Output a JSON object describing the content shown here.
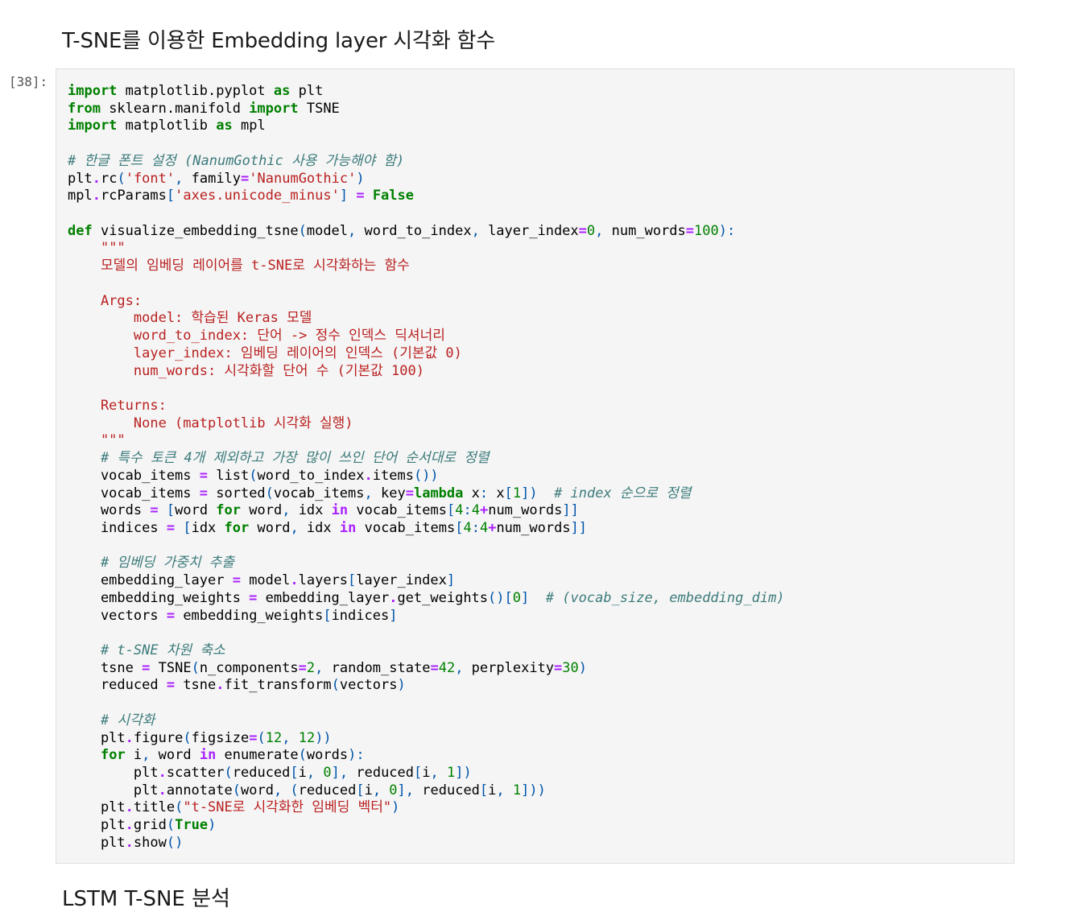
{
  "heading": "T-SNE를 이용한 Embedding layer 시각화 함수",
  "cell": {
    "prompt": "[38]:",
    "lines": [
      [
        [
          "k",
          "import"
        ],
        [
          "t",
          " matplotlib.pyplot "
        ],
        [
          "k",
          "as"
        ],
        [
          "t",
          " plt"
        ]
      ],
      [
        [
          "k",
          "from"
        ],
        [
          "t",
          " sklearn.manifold "
        ],
        [
          "k",
          "import"
        ],
        [
          "t",
          " TSNE"
        ]
      ],
      [
        [
          "k",
          "import"
        ],
        [
          "t",
          " matplotlib "
        ],
        [
          "k",
          "as"
        ],
        [
          "t",
          " mpl"
        ]
      ],
      [],
      [
        [
          "c",
          "# 한글 폰트 설정 (NanumGothic 사용 가능해야 함)"
        ]
      ],
      [
        [
          "t",
          "plt"
        ],
        [
          "o",
          "."
        ],
        [
          "t",
          "rc"
        ],
        [
          "p",
          "("
        ],
        [
          "s",
          "'font'"
        ],
        [
          "p",
          ", "
        ],
        [
          "t",
          "family"
        ],
        [
          "o",
          "="
        ],
        [
          "s",
          "'NanumGothic'"
        ],
        [
          "p",
          ")"
        ]
      ],
      [
        [
          "t",
          "mpl"
        ],
        [
          "o",
          "."
        ],
        [
          "t",
          "rcParams"
        ],
        [
          "p",
          "["
        ],
        [
          "s",
          "'axes.unicode_minus'"
        ],
        [
          "p",
          "]"
        ],
        [
          "t",
          " "
        ],
        [
          "o",
          "="
        ],
        [
          "t",
          " "
        ],
        [
          "k",
          "False"
        ]
      ],
      [],
      [
        [
          "k",
          "def"
        ],
        [
          "t",
          " visualize_embedding_tsne"
        ],
        [
          "p",
          "("
        ],
        [
          "t",
          "model"
        ],
        [
          "p",
          ", "
        ],
        [
          "t",
          "word_to_index"
        ],
        [
          "p",
          ", "
        ],
        [
          "t",
          "layer_index"
        ],
        [
          "o",
          "="
        ],
        [
          "n",
          "0"
        ],
        [
          "p",
          ", "
        ],
        [
          "t",
          "num_words"
        ],
        [
          "o",
          "="
        ],
        [
          "n",
          "100"
        ],
        [
          "p",
          "):"
        ]
      ],
      [
        [
          "t",
          "    "
        ],
        [
          "s",
          "\"\"\""
        ]
      ],
      [
        [
          "s",
          "    모델의 임베딩 레이어를 t-SNE로 시각화하는 함수"
        ]
      ],
      [],
      [
        [
          "s",
          "    Args:"
        ]
      ],
      [
        [
          "s",
          "        model: 학습된 Keras 모델"
        ]
      ],
      [
        [
          "s",
          "        word_to_index: 단어 -> 정수 인덱스 딕셔너리"
        ]
      ],
      [
        [
          "s",
          "        layer_index: 임베딩 레이어의 인덱스 (기본값 0)"
        ]
      ],
      [
        [
          "s",
          "        num_words: 시각화할 단어 수 (기본값 100)"
        ]
      ],
      [],
      [
        [
          "s",
          "    Returns:"
        ]
      ],
      [
        [
          "s",
          "        None (matplotlib 시각화 실행)"
        ]
      ],
      [
        [
          "s",
          "    \"\"\""
        ]
      ],
      [
        [
          "t",
          "    "
        ],
        [
          "c",
          "# 특수 토큰 4개 제외하고 가장 많이 쓰인 단어 순서대로 정렬"
        ]
      ],
      [
        [
          "t",
          "    vocab_items "
        ],
        [
          "o",
          "="
        ],
        [
          "t",
          " list"
        ],
        [
          "p",
          "("
        ],
        [
          "t",
          "word_to_index"
        ],
        [
          "o",
          "."
        ],
        [
          "t",
          "items"
        ],
        [
          "p",
          "())"
        ]
      ],
      [
        [
          "t",
          "    vocab_items "
        ],
        [
          "o",
          "="
        ],
        [
          "t",
          " sorted"
        ],
        [
          "p",
          "("
        ],
        [
          "t",
          "vocab_items"
        ],
        [
          "p",
          ", "
        ],
        [
          "t",
          "key"
        ],
        [
          "o",
          "="
        ],
        [
          "k",
          "lambda"
        ],
        [
          "t",
          " x"
        ],
        [
          "p",
          ":"
        ],
        [
          "t",
          " x"
        ],
        [
          "p",
          "["
        ],
        [
          "n",
          "1"
        ],
        [
          "p",
          "])"
        ],
        [
          "t",
          "  "
        ],
        [
          "c",
          "# index 순으로 정렬"
        ]
      ],
      [
        [
          "t",
          "    words "
        ],
        [
          "o",
          "="
        ],
        [
          "t",
          " "
        ],
        [
          "p",
          "["
        ],
        [
          "t",
          "word "
        ],
        [
          "k",
          "for"
        ],
        [
          "t",
          " word"
        ],
        [
          "p",
          ", "
        ],
        [
          "t",
          "idx "
        ],
        [
          "o",
          "in"
        ],
        [
          "t",
          " vocab_items"
        ],
        [
          "p",
          "["
        ],
        [
          "n",
          "4"
        ],
        [
          "p",
          ":"
        ],
        [
          "n",
          "4"
        ],
        [
          "o",
          "+"
        ],
        [
          "t",
          "num_words"
        ],
        [
          "p",
          "]]"
        ]
      ],
      [
        [
          "t",
          "    indices "
        ],
        [
          "o",
          "="
        ],
        [
          "t",
          " "
        ],
        [
          "p",
          "["
        ],
        [
          "t",
          "idx "
        ],
        [
          "k",
          "for"
        ],
        [
          "t",
          " word"
        ],
        [
          "p",
          ", "
        ],
        [
          "t",
          "idx "
        ],
        [
          "o",
          "in"
        ],
        [
          "t",
          " vocab_items"
        ],
        [
          "p",
          "["
        ],
        [
          "n",
          "4"
        ],
        [
          "p",
          ":"
        ],
        [
          "n",
          "4"
        ],
        [
          "o",
          "+"
        ],
        [
          "t",
          "num_words"
        ],
        [
          "p",
          "]]"
        ]
      ],
      [],
      [
        [
          "t",
          "    "
        ],
        [
          "c",
          "# 임베딩 가중치 추출"
        ]
      ],
      [
        [
          "t",
          "    embedding_layer "
        ],
        [
          "o",
          "="
        ],
        [
          "t",
          " model"
        ],
        [
          "o",
          "."
        ],
        [
          "t",
          "layers"
        ],
        [
          "p",
          "["
        ],
        [
          "t",
          "layer_index"
        ],
        [
          "p",
          "]"
        ]
      ],
      [
        [
          "t",
          "    embedding_weights "
        ],
        [
          "o",
          "="
        ],
        [
          "t",
          " embedding_layer"
        ],
        [
          "o",
          "."
        ],
        [
          "t",
          "get_weights"
        ],
        [
          "p",
          "()["
        ],
        [
          "n",
          "0"
        ],
        [
          "p",
          "]"
        ],
        [
          "t",
          "  "
        ],
        [
          "c",
          "# (vocab_size, embedding_dim)"
        ]
      ],
      [
        [
          "t",
          "    vectors "
        ],
        [
          "o",
          "="
        ],
        [
          "t",
          " embedding_weights"
        ],
        [
          "p",
          "["
        ],
        [
          "t",
          "indices"
        ],
        [
          "p",
          "]"
        ]
      ],
      [],
      [
        [
          "t",
          "    "
        ],
        [
          "c",
          "# t-SNE 차원 축소"
        ]
      ],
      [
        [
          "t",
          "    tsne "
        ],
        [
          "o",
          "="
        ],
        [
          "t",
          " TSNE"
        ],
        [
          "p",
          "("
        ],
        [
          "t",
          "n_components"
        ],
        [
          "o",
          "="
        ],
        [
          "n",
          "2"
        ],
        [
          "p",
          ", "
        ],
        [
          "t",
          "random_state"
        ],
        [
          "o",
          "="
        ],
        [
          "n",
          "42"
        ],
        [
          "p",
          ", "
        ],
        [
          "t",
          "perplexity"
        ],
        [
          "o",
          "="
        ],
        [
          "n",
          "30"
        ],
        [
          "p",
          ")"
        ]
      ],
      [
        [
          "t",
          "    reduced "
        ],
        [
          "o",
          "="
        ],
        [
          "t",
          " tsne"
        ],
        [
          "o",
          "."
        ],
        [
          "t",
          "fit_transform"
        ],
        [
          "p",
          "("
        ],
        [
          "t",
          "vectors"
        ],
        [
          "p",
          ")"
        ]
      ],
      [],
      [
        [
          "t",
          "    "
        ],
        [
          "c",
          "# 시각화"
        ]
      ],
      [
        [
          "t",
          "    plt"
        ],
        [
          "o",
          "."
        ],
        [
          "t",
          "figure"
        ],
        [
          "p",
          "("
        ],
        [
          "t",
          "figsize"
        ],
        [
          "o",
          "="
        ],
        [
          "p",
          "("
        ],
        [
          "n",
          "12"
        ],
        [
          "p",
          ", "
        ],
        [
          "n",
          "12"
        ],
        [
          "p",
          "))"
        ]
      ],
      [
        [
          "t",
          "    "
        ],
        [
          "k",
          "for"
        ],
        [
          "t",
          " i"
        ],
        [
          "p",
          ", "
        ],
        [
          "t",
          "word "
        ],
        [
          "o",
          "in"
        ],
        [
          "t",
          " enumerate"
        ],
        [
          "p",
          "("
        ],
        [
          "t",
          "words"
        ],
        [
          "p",
          "):"
        ]
      ],
      [
        [
          "t",
          "        plt"
        ],
        [
          "o",
          "."
        ],
        [
          "t",
          "scatter"
        ],
        [
          "p",
          "("
        ],
        [
          "t",
          "reduced"
        ],
        [
          "p",
          "["
        ],
        [
          "t",
          "i"
        ],
        [
          "p",
          ", "
        ],
        [
          "n",
          "0"
        ],
        [
          "p",
          "], "
        ],
        [
          "t",
          "reduced"
        ],
        [
          "p",
          "["
        ],
        [
          "t",
          "i"
        ],
        [
          "p",
          ", "
        ],
        [
          "n",
          "1"
        ],
        [
          "p",
          "])"
        ]
      ],
      [
        [
          "t",
          "        plt"
        ],
        [
          "o",
          "."
        ],
        [
          "t",
          "annotate"
        ],
        [
          "p",
          "("
        ],
        [
          "t",
          "word"
        ],
        [
          "p",
          ", ("
        ],
        [
          "t",
          "reduced"
        ],
        [
          "p",
          "["
        ],
        [
          "t",
          "i"
        ],
        [
          "p",
          ", "
        ],
        [
          "n",
          "0"
        ],
        [
          "p",
          "], "
        ],
        [
          "t",
          "reduced"
        ],
        [
          "p",
          "["
        ],
        [
          "t",
          "i"
        ],
        [
          "p",
          ", "
        ],
        [
          "n",
          "1"
        ],
        [
          "p",
          "]))"
        ]
      ],
      [
        [
          "t",
          "    plt"
        ],
        [
          "o",
          "."
        ],
        [
          "t",
          "title"
        ],
        [
          "p",
          "("
        ],
        [
          "s",
          "\"t-SNE로 시각화한 임베딩 벡터\""
        ],
        [
          "p",
          ")"
        ]
      ],
      [
        [
          "t",
          "    plt"
        ],
        [
          "o",
          "."
        ],
        [
          "t",
          "grid"
        ],
        [
          "p",
          "("
        ],
        [
          "k",
          "True"
        ],
        [
          "p",
          ")"
        ]
      ],
      [
        [
          "t",
          "    plt"
        ],
        [
          "o",
          "."
        ],
        [
          "t",
          "show"
        ],
        [
          "p",
          "()"
        ]
      ]
    ]
  },
  "next_heading": "LSTM T-SNE 분석"
}
